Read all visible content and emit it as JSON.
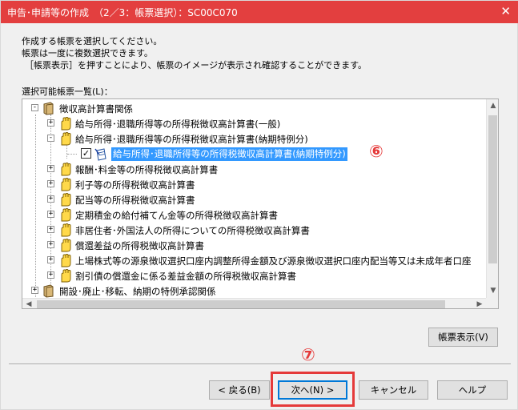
{
  "window": {
    "title": "申告･申請等の作成　（2／3：帳票選択）：SC00C070",
    "close_glyph": "✕",
    "titlebar_color": "#e33f3f"
  },
  "instructions": [
    "作成する帳票を選択してください。",
    "帳票は一度に複数選択できます。",
    "［帳票表示］を押すことにより、帳票のイメージが表示され確認することができます。"
  ],
  "list_label": "選択可能帳票一覧(L)：",
  "tree": {
    "root": "徴収高計算書関係",
    "items": [
      {
        "label": "給与所得･退職所得等の所得税徴収高計算書(一般)",
        "expander": "+"
      },
      {
        "label": "給与所得･退職所得等の所得税徴収高計算書(納期特例分)",
        "expander": "-"
      },
      {
        "label": "給与所得･退職所得等の所得税徴収高計算書(納期特例分)",
        "expander": "",
        "checked": "✓",
        "selected": true
      },
      {
        "label": "報酬･料金等の所得税徴収高計算書",
        "expander": "+"
      },
      {
        "label": "利子等の所得税徴収高計算書",
        "expander": "+"
      },
      {
        "label": "配当等の所得税徴収高計算書",
        "expander": "+"
      },
      {
        "label": "定期積金の給付補てん金等の所得税徴収高計算書",
        "expander": "+"
      },
      {
        "label": "非居住者･外国法人の所得についての所得税徴収高計算書",
        "expander": "+"
      },
      {
        "label": "償還差益の所得税徴収高計算書",
        "expander": "+"
      },
      {
        "label": "上場株式等の源泉徴収選択口座内調整所得金額及び源泉徴収選択口座内配当等又は未成年者口座",
        "expander": "+"
      },
      {
        "label": "割引債の償還金に係る差益金額の所得税徴収高計算書",
        "expander": "+"
      }
    ],
    "second_root": "開設･廃止･移転、納期の特例承認関係",
    "selection_color": "#3399ff"
  },
  "buttons": {
    "preview": "帳票表示(V)",
    "back": "< 戻る(B)",
    "next": "次へ(N) >",
    "cancel": "キャンセル",
    "help": "ヘルプ"
  },
  "annotations": {
    "marker_6": "⑥",
    "marker_7": "⑦",
    "color": "#e53a3a"
  },
  "icons": {
    "close": "close-icon",
    "hand": "hand-icon",
    "book": "book-icon",
    "form": "form-icon"
  }
}
